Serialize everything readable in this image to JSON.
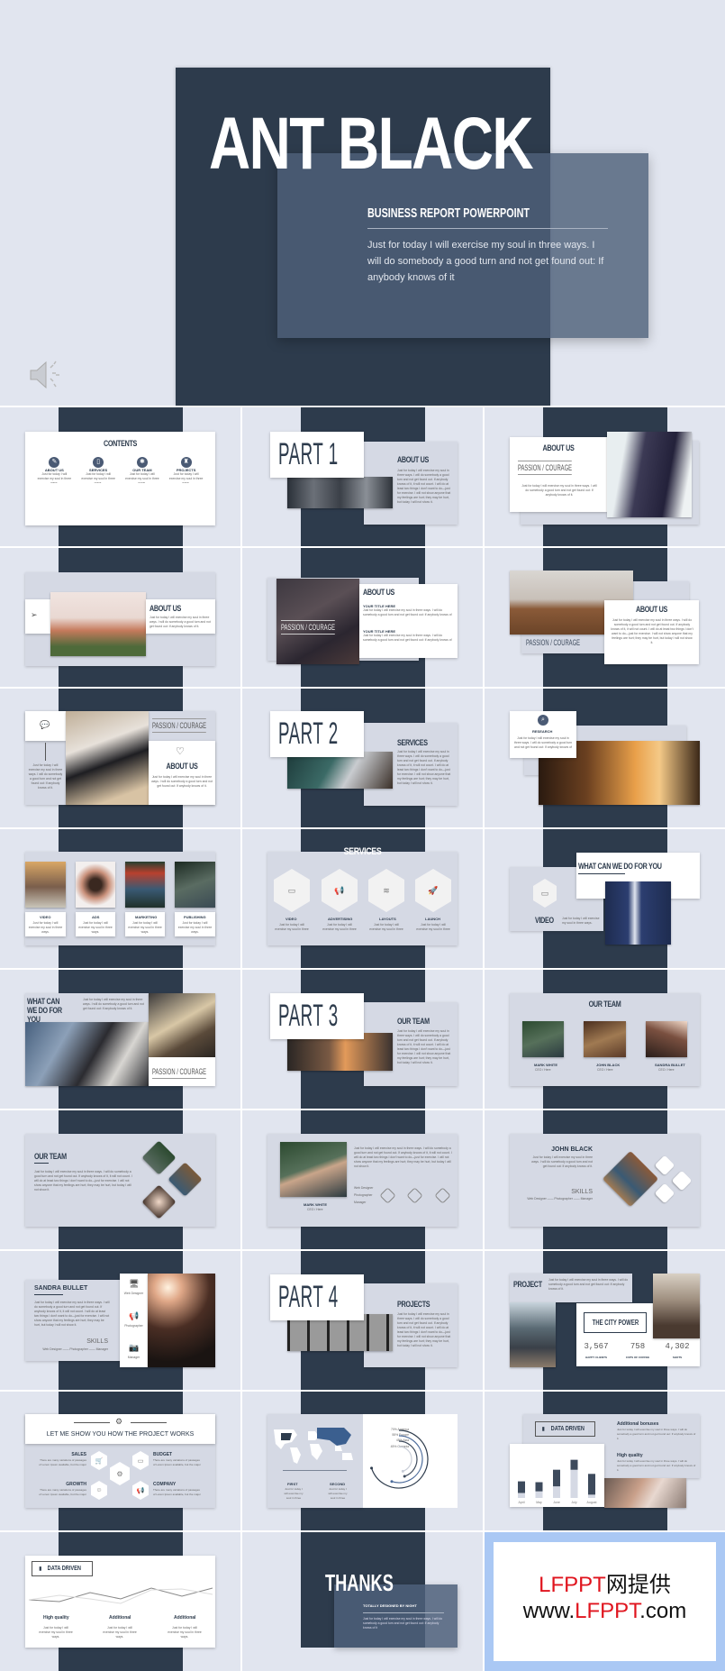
{
  "hero": {
    "title": "ANT BLACK",
    "subtitle": "BUSINESS REPORT POWERPOINT",
    "body": "Just for today I will exercise my soul in three ways. I will do somebody a good turn and not get found out: If anybody knows of it",
    "speaker_icon": "speaker-icon"
  },
  "colors": {
    "background": "#e1e5ef",
    "dark": "#2d3b4c",
    "panel": "#d5d9e4",
    "accent_blue": "#aac8f4",
    "brand_red": "#e0141e"
  },
  "lorem": {
    "short": "Just for today I will exercise my soul in three ways.",
    "mid": "Just for today I will exercise my soul in three ways. I will do somebody a good turn and not get found out: If anybody knows of it.",
    "long": "Just for today I will exercise my soul in three ways. I will do somebody a good turn and not get found out. If anybody knows of it, it will not count. I will do at least two things I don't want to do—just for exercise. I will not show anyone that my feelings are hurt; they may be hurt, but today I will not show it."
  },
  "slides": [
    {
      "title": "CONTENTS",
      "items": [
        "ABOUT US",
        "SERVICES",
        "OUR TEAM",
        "PROJECTS"
      ]
    },
    {
      "part": "PART 1",
      "title": "ABOUT US"
    },
    {
      "title": "ABOUT US",
      "tagline": "PASSION / COURAGE"
    },
    {
      "title": "ABOUT US"
    },
    {
      "title": "ABOUT US",
      "tagline": "PASSION / COURAGE",
      "sub1": "YOUR TITLE HERE",
      "sub2": "YOUR TITLE HERE"
    },
    {
      "title": "ABOUT US",
      "tagline": "PASSION / COURAGE"
    },
    {
      "title": "ABOUT US",
      "tagline": "PASSION / COURAGE"
    },
    {
      "part": "PART 2",
      "title": "SERVICES"
    },
    {
      "title": "RESEARCH"
    },
    {
      "items": [
        "VIDEO",
        "ADS",
        "MARKETING",
        "PUBLISHING"
      ]
    },
    {
      "title": "SERVICES",
      "items": [
        "VIDEO",
        "ADVERTISING",
        "LAYOUTS",
        "LAUNCH"
      ]
    },
    {
      "title": "WHAT CAN WE DO FOR YOU",
      "item": "VIDEO"
    },
    {
      "title": "WHAT CAN WE DO FOR YOU",
      "tagline": "PASSION / COURAGE"
    },
    {
      "part": "PART 3",
      "title": "OUR TEAM"
    },
    {
      "title": "OUR TEAM",
      "names": [
        "MARK WHITE",
        "JOHN BLACK",
        "SANDRA BULLET"
      ],
      "role": "CEO / Here"
    },
    {
      "title": "OUR TEAM"
    },
    {
      "name": "MARK WHITE",
      "role": "CEO / Here",
      "skills": [
        "Web Designer",
        "Photographer",
        "Manager"
      ]
    },
    {
      "name": "JOHN BLACK",
      "skills_title": "SKILLS",
      "skills_line": "Web Designer —— Photographer —— Manager"
    },
    {
      "name": "SANDRA BULLET",
      "skills_title": "SKILLS",
      "skills_line": "Web Designer —— Photographer —— Manager",
      "skills": [
        "Web Designer",
        "Photographer",
        "Manager"
      ]
    },
    {
      "part": "PART 4",
      "title": "PROJECTS"
    },
    {
      "title": "PROJECT",
      "banner": "THE CITY POWER",
      "stats": [
        {
          "value": "3,567",
          "label": "HAPPY CLIENTS"
        },
        {
          "value": "758",
          "label": "CUPS OF COFFEE"
        },
        {
          "value": "4,302",
          "label": "SHOTS"
        }
      ]
    },
    {
      "title": "LET ME SHOW YOU HOW THE PROJECT WORKS",
      "items": [
        "SALES",
        "BUDGET",
        "GROWTH",
        "COMPANY"
      ],
      "item_text": "There are many variations of passages of Lorem Ipsum available, but the major"
    },
    {
      "legend": [
        "70% America",
        "55% Europe",
        "45% Asia",
        "45% Oceania"
      ],
      "arc_percents": [
        70,
        55,
        45,
        45
      ],
      "cols": [
        "FIRST",
        "SECOND"
      ]
    },
    {
      "title": "DATA DRIVEN",
      "h1": "Additional bonuses",
      "h2": "High quality",
      "bars": [
        {
          "label": "April",
          "total": 20,
          "dark": 14
        },
        {
          "label": "May",
          "total": 19,
          "dark": 11
        },
        {
          "label": "June",
          "total": 34,
          "dark": 20
        },
        {
          "label": "July",
          "total": 46,
          "dark": 12
        },
        {
          "label": "August",
          "total": 29,
          "dark": 25
        }
      ]
    },
    {
      "title": "DATA DRIVEN",
      "cols": [
        "High quality",
        "Additional",
        "Additional"
      ]
    },
    {
      "title": "THANKS",
      "subtitle": "TOTALLY DESIGNED BY NIGHT"
    },
    {
      "line1_red": "LFPPT",
      "line1_black": "网提供",
      "line2_pre": "www.",
      "line2_red": "LFPPT",
      "line2_post": ".com"
    }
  ]
}
